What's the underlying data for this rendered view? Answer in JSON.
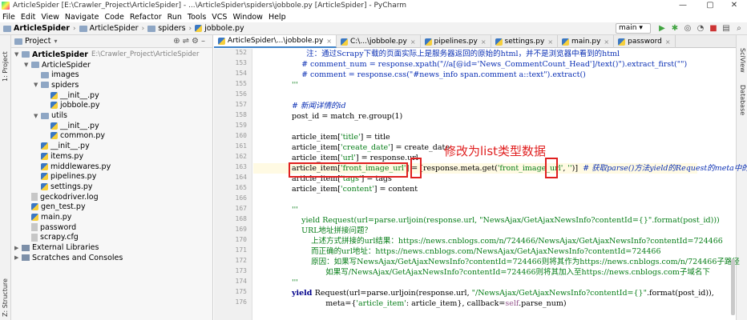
{
  "window": {
    "title": "ArticleSpider [E:\\Crawler_Project\\ArticleSpider] - ...\\ArticleSpider\\spiders\\jobbole.py [ArticleSpider] - PyCharm",
    "controls": [
      "—",
      "▢",
      "✕"
    ]
  },
  "menu": [
    "File",
    "Edit",
    "View",
    "Navigate",
    "Code",
    "Refactor",
    "Run",
    "Tools",
    "VCS",
    "Window",
    "Help"
  ],
  "breadcrumb": [
    "ArticleSpider",
    "ArticleSpider",
    "spiders",
    "jobbole.py"
  ],
  "branch": "main",
  "left_stripe": {
    "project": "1: Project",
    "structure": "Z: Structure"
  },
  "right_stripe": {
    "scview": "SciView",
    "database": "Database"
  },
  "project_panel": {
    "title": "Project",
    "tree": [
      {
        "label": "ArticleSpider",
        "path": "E:\\Crawler_Project\\ArticleSpider",
        "icon": "folder",
        "depth": 0,
        "arrow": "▼",
        "bold": true
      },
      {
        "label": "ArticleSpider",
        "icon": "folder",
        "depth": 1,
        "arrow": "▼"
      },
      {
        "label": "images",
        "icon": "folder",
        "depth": 2,
        "arrow": ""
      },
      {
        "label": "spiders",
        "icon": "folder",
        "depth": 2,
        "arrow": "▼"
      },
      {
        "label": "__init__.py",
        "icon": "python",
        "depth": 3,
        "arrow": ""
      },
      {
        "label": "jobbole.py",
        "icon": "python",
        "depth": 3,
        "arrow": ""
      },
      {
        "label": "utils",
        "icon": "folder",
        "depth": 2,
        "arrow": "▼"
      },
      {
        "label": "__init__.py",
        "icon": "python",
        "depth": 3,
        "arrow": ""
      },
      {
        "label": "common.py",
        "icon": "python",
        "depth": 3,
        "arrow": ""
      },
      {
        "label": "__init__.py",
        "icon": "python",
        "depth": 2,
        "arrow": ""
      },
      {
        "label": "items.py",
        "icon": "python",
        "depth": 2,
        "arrow": ""
      },
      {
        "label": "middlewares.py",
        "icon": "python",
        "depth": 2,
        "arrow": ""
      },
      {
        "label": "pipelines.py",
        "icon": "python",
        "depth": 2,
        "arrow": ""
      },
      {
        "label": "settings.py",
        "icon": "python",
        "depth": 2,
        "arrow": ""
      },
      {
        "label": "geckodriver.log",
        "icon": "file",
        "depth": 1,
        "arrow": ""
      },
      {
        "label": "gen_test.py",
        "icon": "python",
        "depth": 1,
        "arrow": ""
      },
      {
        "label": "main.py",
        "icon": "python",
        "depth": 1,
        "arrow": ""
      },
      {
        "label": "password",
        "icon": "file",
        "depth": 1,
        "arrow": ""
      },
      {
        "label": "scrapy.cfg",
        "icon": "file",
        "depth": 1,
        "arrow": ""
      },
      {
        "label": "External Libraries",
        "icon": "library",
        "depth": 0,
        "arrow": "▶"
      },
      {
        "label": "Scratches and Consoles",
        "icon": "library",
        "depth": 0,
        "arrow": "▶"
      }
    ]
  },
  "tabs": [
    {
      "label": "ArticleSpider\\...\\jobbole.py",
      "active": true
    },
    {
      "label": "C:\\...\\jobbole.py",
      "active": false
    },
    {
      "label": "pipelines.py",
      "active": false
    },
    {
      "label": "settings.py",
      "active": false
    },
    {
      "label": "main.py",
      "active": false
    },
    {
      "label": "password",
      "active": false
    }
  ],
  "editor": {
    "line_numbers": [
      "152",
      "153",
      "154",
      "155",
      "156",
      "157",
      "158",
      "159",
      "160",
      "161",
      "162",
      "163",
      "164",
      "165",
      "166",
      "167",
      "168",
      "169",
      "170",
      "171",
      "172",
      "173",
      "174",
      "175",
      "176"
    ],
    "lines": [
      [
        {
          "t": "      注：通过Scrapy下载的页面实际上是服务器返回的原始的html，并不是浏览器中看到的html",
          "c": "cm"
        }
      ],
      [
        {
          "t": "    # comment_num = response.xpath(\"//a[@id='News_CommentCount_Head']/text()\").extract_first(\"\")",
          "c": "cm"
        }
      ],
      [
        {
          "t": "    # comment = response.css(\"#news_info span.comment a::text\").extract()",
          "c": "cm"
        }
      ],
      [
        {
          "t": "'''",
          "c": "str"
        }
      ],
      [
        {
          "t": "",
          "c": ""
        }
      ],
      [
        {
          "t": "# 新闻详情的id",
          "c": "cm-i"
        }
      ],
      [
        {
          "t": "post_id = match_re.group(1)",
          "c": ""
        }
      ],
      [
        {
          "t": "",
          "c": ""
        }
      ],
      [
        {
          "t": "article_item[",
          "c": ""
        },
        {
          "t": "'title'",
          "c": "str"
        },
        {
          "t": "] = title",
          "c": ""
        }
      ],
      [
        {
          "t": "article_item[",
          "c": ""
        },
        {
          "t": "'create_date'",
          "c": "str"
        },
        {
          "t": "] = create_date",
          "c": ""
        }
      ],
      [
        {
          "t": "article_item[",
          "c": ""
        },
        {
          "t": "'url'",
          "c": "str"
        },
        {
          "t": "] = response.url",
          "c": ""
        }
      ],
      [
        {
          "t": "article_item[",
          "c": ""
        },
        {
          "t": "'front_image_url'",
          "c": "str"
        },
        {
          "t": "] = [response.meta.get(",
          "c": ""
        },
        {
          "t": "'front_image_url'",
          "c": "str"
        },
        {
          "t": ", ",
          "c": ""
        },
        {
          "t": "''",
          "c": "str"
        },
        {
          "t": ")]  ",
          "c": ""
        },
        {
          "t": "# 获取parse()方法yield的Request的meta中的值",
          "c": "cm-i"
        }
      ],
      [
        {
          "t": "article_item[",
          "c": ""
        },
        {
          "t": "'tags'",
          "c": "str"
        },
        {
          "t": "] = tags",
          "c": ""
        }
      ],
      [
        {
          "t": "article_item[",
          "c": ""
        },
        {
          "t": "'content'",
          "c": "str"
        },
        {
          "t": "] = content",
          "c": ""
        }
      ],
      [
        {
          "t": "",
          "c": ""
        }
      ],
      [
        {
          "t": "'''",
          "c": "str"
        }
      ],
      [
        {
          "t": "    yield Request(url=parse.urljoin(response.url, \"NewsAjax/GetAjaxNewsInfo?contentId={}\".format(post_id)))",
          "c": "str"
        }
      ],
      [
        {
          "t": "    URL地址拼接问题？",
          "c": "str"
        }
      ],
      [
        {
          "t": "        上述方式拼接的url结果：https://news.cnblogs.com/n/724466/NewsAjax/GetAjaxNewsInfo?contentId=724466",
          "c": "str"
        }
      ],
      [
        {
          "t": "        而正确的url地址：https://news.cnblogs.com/NewsAjax/GetAjaxNewsInfo?contentId=724466",
          "c": "str"
        }
      ],
      [
        {
          "t": "        原因：如果写NewsAjax/GetAjaxNewsInfo?contentId=724466则将其作为https://news.cnblogs.com/n/724466子路径",
          "c": "str"
        }
      ],
      [
        {
          "t": "              如果写/NewsAjax/GetAjaxNewsInfo?contentId=724466则将其加入至https://news.cnblogs.com子域名下",
          "c": "str"
        }
      ],
      [
        {
          "t": "'''",
          "c": "str"
        }
      ],
      [
        {
          "t": "yield ",
          "c": "kw"
        },
        {
          "t": "Request(url=parse.urljoin(response.url, ",
          "c": ""
        },
        {
          "t": "\"/NewsAjax/GetAjaxNewsInfo?contentId={}\"",
          "c": "str"
        },
        {
          "t": ".format(post_id)),",
          "c": ""
        }
      ],
      [
        {
          "t": "              meta={",
          "c": ""
        },
        {
          "t": "'article_item'",
          "c": "str"
        },
        {
          "t": ": article_item}, callback=",
          "c": ""
        },
        {
          "t": "self",
          "c": "self"
        },
        {
          "t": ".parse_num)",
          "c": ""
        }
      ]
    ],
    "current_line_index": 11
  },
  "annotation": {
    "text": "修改为list类型数据",
    "color": "#e02020"
  }
}
